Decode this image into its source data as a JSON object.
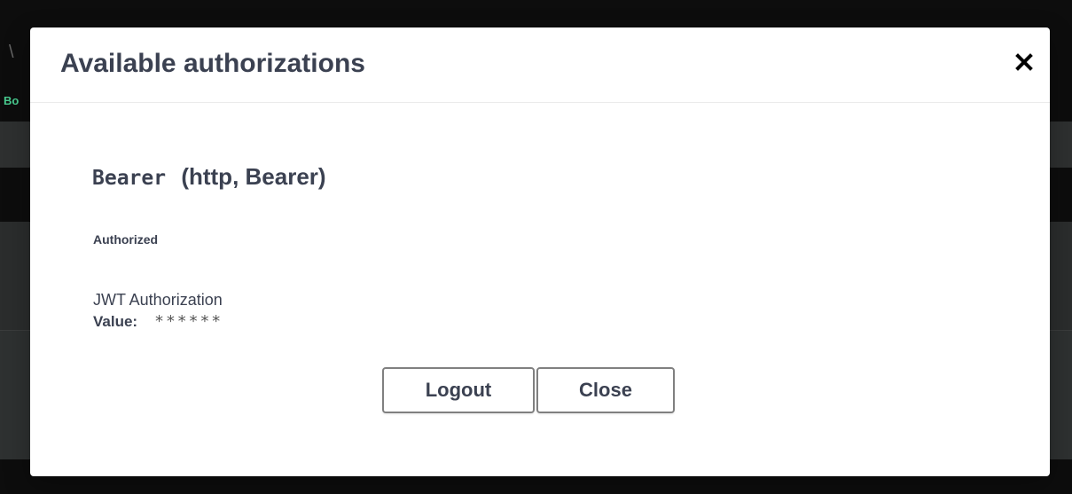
{
  "background": {
    "fragment_text": "Bo"
  },
  "modal": {
    "title": "Available authorizations",
    "close_icon": "close-icon",
    "scheme": {
      "name": "Bearer",
      "type_text": "(http, Bearer)"
    },
    "status": "Authorized",
    "description": "JWT Authorization",
    "value_label": "Value:",
    "value": "******",
    "buttons": {
      "logout_label": "Logout",
      "close_label": "Close"
    }
  },
  "colors": {
    "text": "#3b4151",
    "button_border": "#808080",
    "modal_bg": "#ffffff",
    "backdrop": "#0d0d0d"
  }
}
